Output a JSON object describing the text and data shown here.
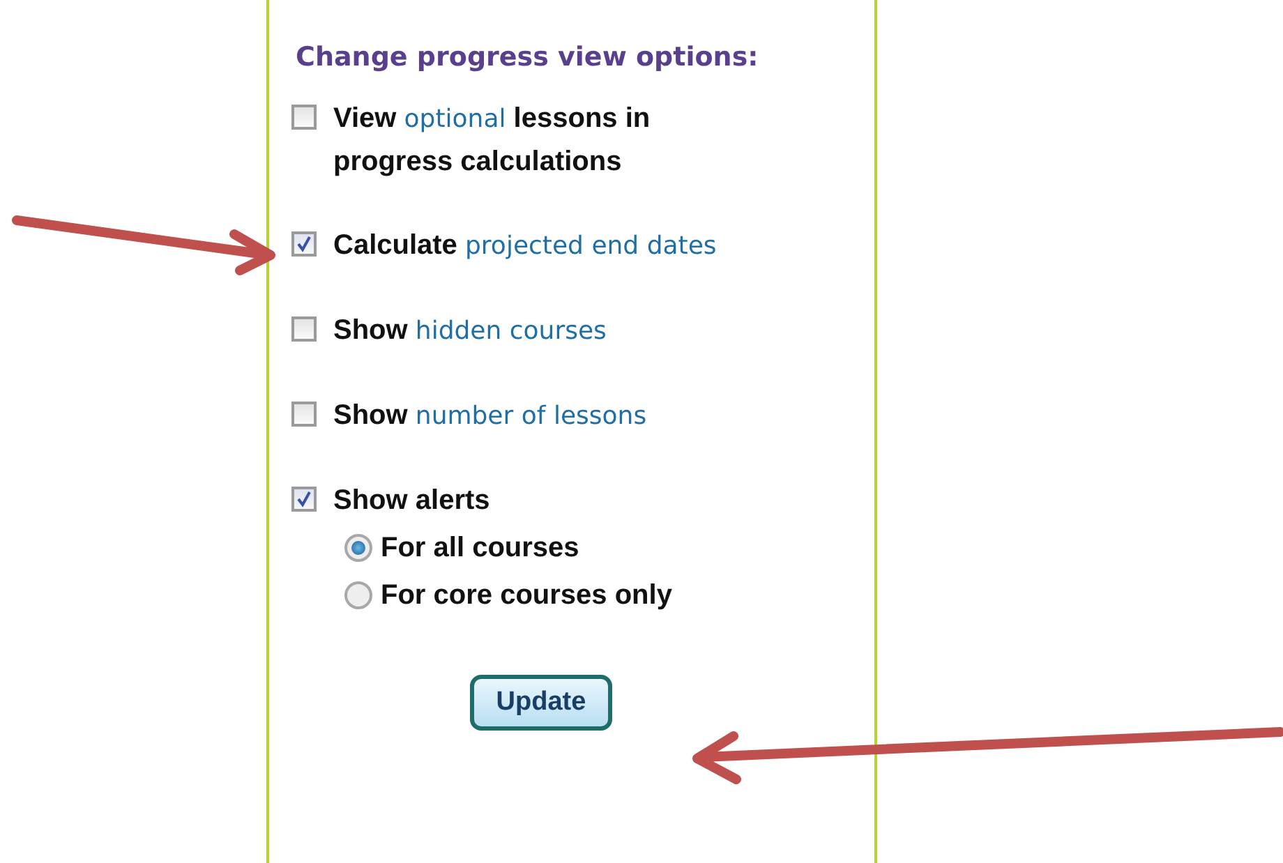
{
  "panel": {
    "title": "Change progress view options:",
    "options": [
      {
        "checked": false,
        "parts": [
          {
            "text": "View",
            "kind": "plain"
          },
          {
            "text": "optional",
            "kind": "link"
          },
          {
            "text": "lessons in progress calculations",
            "kind": "plain"
          }
        ]
      },
      {
        "checked": true,
        "parts": [
          {
            "text": "Calculate",
            "kind": "plain"
          },
          {
            "text": "projected end dates",
            "kind": "link"
          }
        ]
      },
      {
        "checked": false,
        "parts": [
          {
            "text": "Show",
            "kind": "plain"
          },
          {
            "text": "hidden courses",
            "kind": "link"
          }
        ]
      },
      {
        "checked": false,
        "parts": [
          {
            "text": "Show",
            "kind": "plain"
          },
          {
            "text": "number of lessons",
            "kind": "link"
          }
        ]
      },
      {
        "checked": true,
        "parts": [
          {
            "text": "Show alerts",
            "kind": "plain"
          }
        ],
        "choices": [
          {
            "label": "For all courses",
            "selected": true
          },
          {
            "label": "For core courses only",
            "selected": false
          }
        ]
      }
    ],
    "button": "Update"
  }
}
